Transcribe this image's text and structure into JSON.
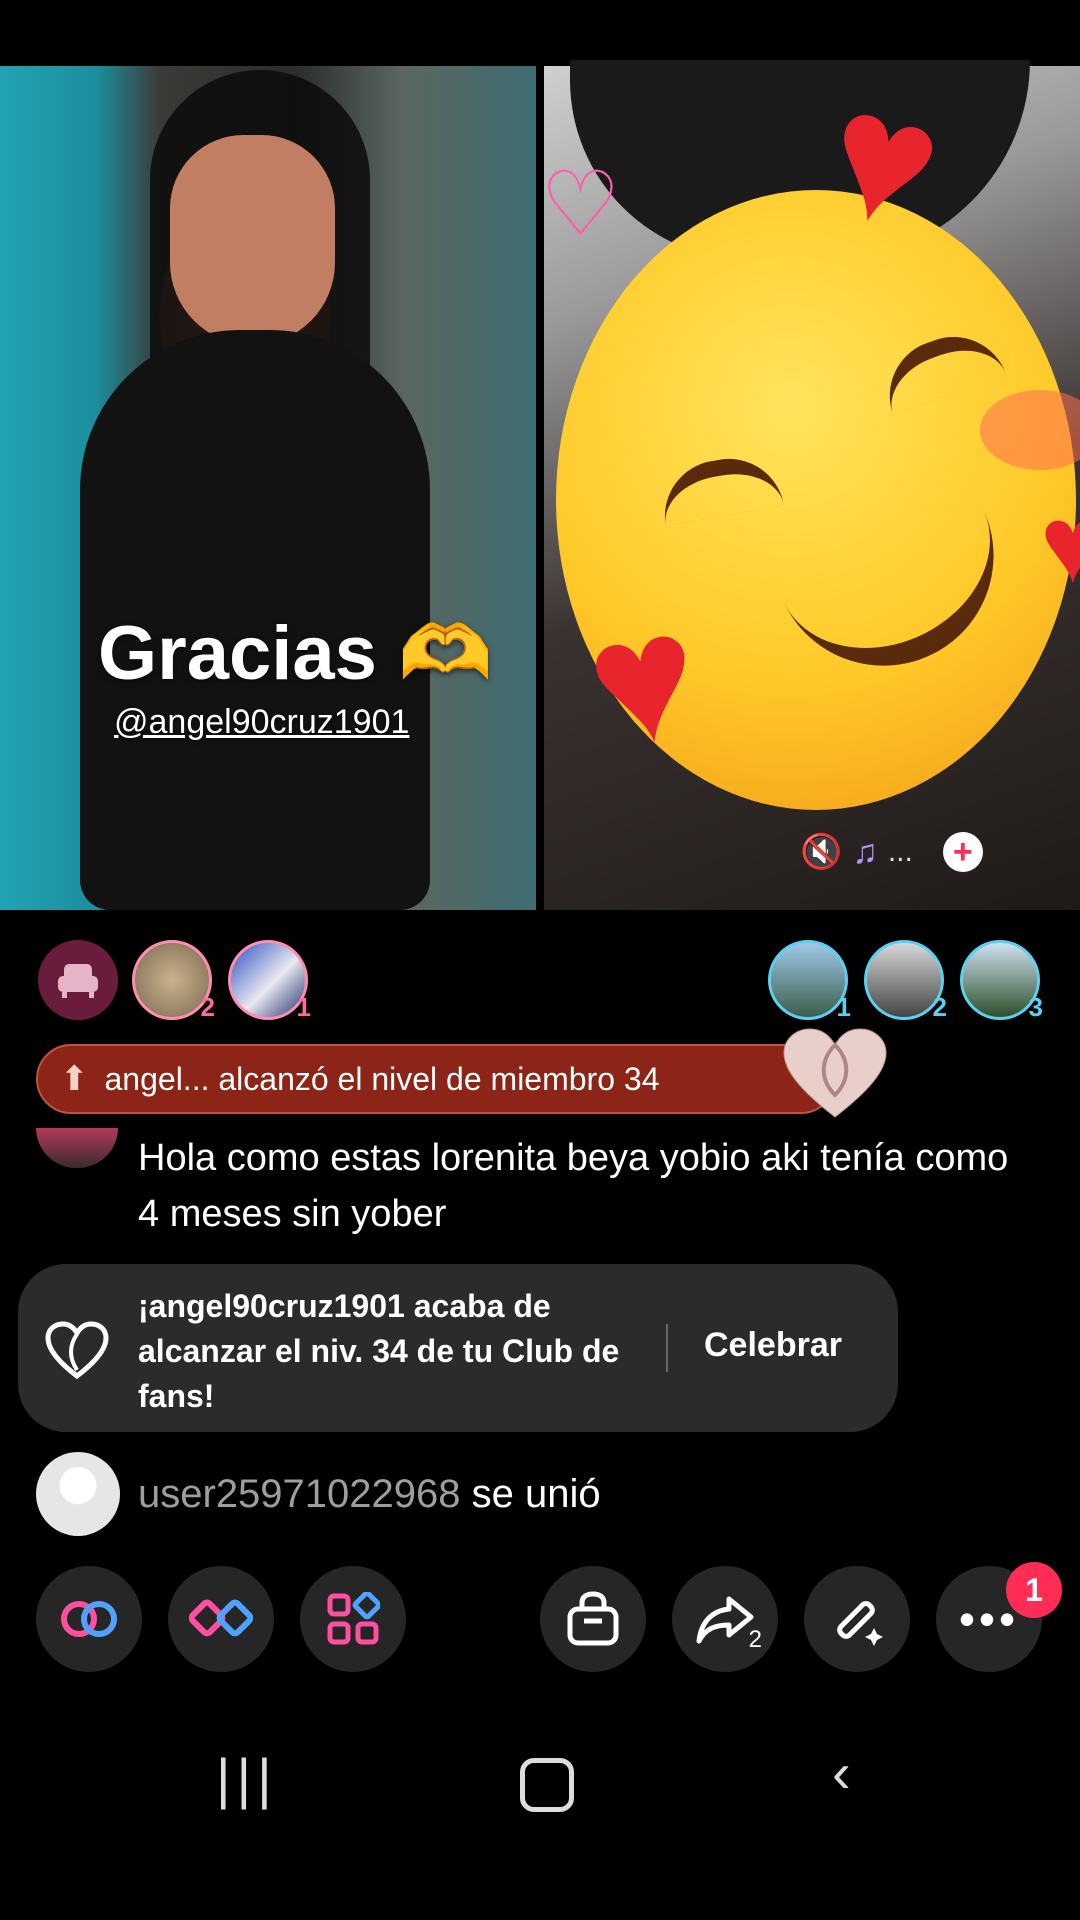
{
  "overlay": {
    "title": "Gracias 🫶",
    "mention": "@angel90cruz1901"
  },
  "guest_controls": {
    "mute_icon": "speaker-mute-icon",
    "music_icon": "music-notes-icon",
    "more": "...",
    "add": "+"
  },
  "viewers_left": [
    {
      "icon": "sofa-seat-icon",
      "rank": ""
    },
    {
      "rank": "2"
    },
    {
      "rank": "1"
    }
  ],
  "viewers_right": [
    {
      "rank": "1"
    },
    {
      "rank": "2"
    },
    {
      "rank": "3"
    }
  ],
  "level_banner": {
    "text": "angel... alcanzó el nivel de miembro 34"
  },
  "chat": {
    "message": "Hola como estas lorenita beya yobio aki tenía como 4 meses sin yober"
  },
  "fan_club": {
    "text": "¡angel90cruz1901 acaba de alcanzar el niv. 34 de tu Club de fans!",
    "action": "Celebrar"
  },
  "join": {
    "user": "user25971022968",
    "action": "se unió"
  },
  "actions": {
    "share_count": "2",
    "more_badge": "1"
  },
  "colors": {
    "accent": "#ff2d55",
    "banner": "#8c2418",
    "card": "#2b2b2b"
  }
}
